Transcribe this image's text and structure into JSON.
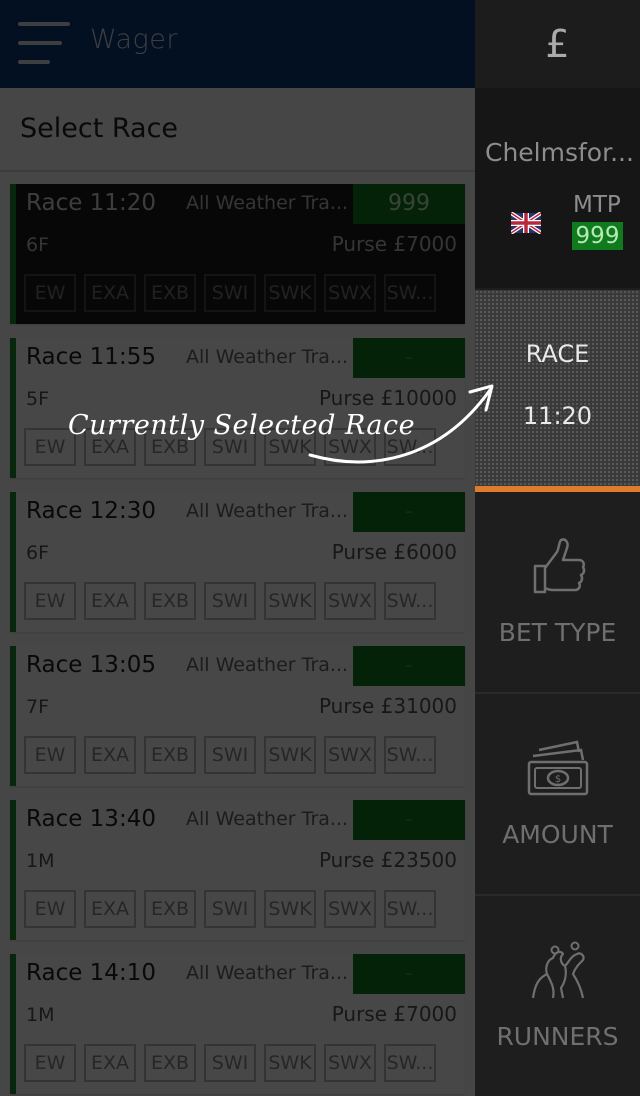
{
  "header": {
    "title": "Wager"
  },
  "section": {
    "title": "Select Race"
  },
  "races": [
    {
      "time": "Race 11:20",
      "track": "All Weather Tra...",
      "mtp": "999",
      "distance": "6F",
      "purse": "Purse £7000",
      "selected": true
    },
    {
      "time": "Race 11:55",
      "track": "All Weather Tra...",
      "mtp": "-",
      "distance": "5F",
      "purse": "Purse £10000",
      "selected": false
    },
    {
      "time": "Race 12:30",
      "track": "All Weather Tra...",
      "mtp": "-",
      "distance": "6F",
      "purse": "Purse £6000",
      "selected": false
    },
    {
      "time": "Race 13:05",
      "track": "All Weather Tra...",
      "mtp": "-",
      "distance": "7F",
      "purse": "Purse £31000",
      "selected": false
    },
    {
      "time": "Race 13:40",
      "track": "All Weather Tra...",
      "mtp": "-",
      "distance": "1M",
      "purse": "Purse £23500",
      "selected": false
    },
    {
      "time": "Race 14:10",
      "track": "All Weather Tra...",
      "mtp": "-",
      "distance": "1M",
      "purse": "Purse £7000",
      "selected": false
    }
  ],
  "bet_types": [
    "EW",
    "EXA",
    "EXB",
    "SWI",
    "SWK",
    "SWX",
    "SW..."
  ],
  "sidebar": {
    "currency": "£",
    "track_name": "Chelmsfor...",
    "flag_icon": "uk-flag-icon",
    "mtp_label": "MTP",
    "mtp_value": "999",
    "race_label": "RACE",
    "race_time": "11:20",
    "tabs": [
      {
        "label": "BET TYPE",
        "icon": "thumbs-up-icon"
      },
      {
        "label": "AMOUNT",
        "icon": "cash-icon"
      },
      {
        "label": "RUNNERS",
        "icon": "horse-racing-icon"
      }
    ]
  },
  "annotation": {
    "text": "Currently Selected Race"
  },
  "colors": {
    "header_blue": "#0c3a7a",
    "mtp_green": "#0f7a1e",
    "race_accent": "#1b8a2e",
    "active_tab_indicator": "#e07a2c"
  }
}
